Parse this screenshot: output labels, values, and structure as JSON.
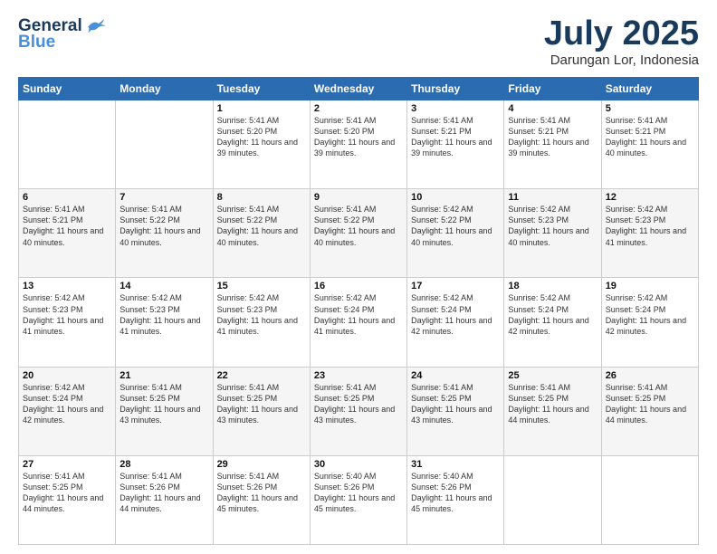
{
  "header": {
    "logo_general": "General",
    "logo_blue": "Blue",
    "month_title": "July 2025",
    "location": "Darungan Lor, Indonesia"
  },
  "weekdays": [
    "Sunday",
    "Monday",
    "Tuesday",
    "Wednesday",
    "Thursday",
    "Friday",
    "Saturday"
  ],
  "weeks": [
    [
      {
        "day": "",
        "info": ""
      },
      {
        "day": "",
        "info": ""
      },
      {
        "day": "1",
        "info": "Sunrise: 5:41 AM\nSunset: 5:20 PM\nDaylight: 11 hours and 39 minutes."
      },
      {
        "day": "2",
        "info": "Sunrise: 5:41 AM\nSunset: 5:20 PM\nDaylight: 11 hours and 39 minutes."
      },
      {
        "day": "3",
        "info": "Sunrise: 5:41 AM\nSunset: 5:21 PM\nDaylight: 11 hours and 39 minutes."
      },
      {
        "day": "4",
        "info": "Sunrise: 5:41 AM\nSunset: 5:21 PM\nDaylight: 11 hours and 39 minutes."
      },
      {
        "day": "5",
        "info": "Sunrise: 5:41 AM\nSunset: 5:21 PM\nDaylight: 11 hours and 40 minutes."
      }
    ],
    [
      {
        "day": "6",
        "info": "Sunrise: 5:41 AM\nSunset: 5:21 PM\nDaylight: 11 hours and 40 minutes."
      },
      {
        "day": "7",
        "info": "Sunrise: 5:41 AM\nSunset: 5:22 PM\nDaylight: 11 hours and 40 minutes."
      },
      {
        "day": "8",
        "info": "Sunrise: 5:41 AM\nSunset: 5:22 PM\nDaylight: 11 hours and 40 minutes."
      },
      {
        "day": "9",
        "info": "Sunrise: 5:41 AM\nSunset: 5:22 PM\nDaylight: 11 hours and 40 minutes."
      },
      {
        "day": "10",
        "info": "Sunrise: 5:42 AM\nSunset: 5:22 PM\nDaylight: 11 hours and 40 minutes."
      },
      {
        "day": "11",
        "info": "Sunrise: 5:42 AM\nSunset: 5:23 PM\nDaylight: 11 hours and 40 minutes."
      },
      {
        "day": "12",
        "info": "Sunrise: 5:42 AM\nSunset: 5:23 PM\nDaylight: 11 hours and 41 minutes."
      }
    ],
    [
      {
        "day": "13",
        "info": "Sunrise: 5:42 AM\nSunset: 5:23 PM\nDaylight: 11 hours and 41 minutes."
      },
      {
        "day": "14",
        "info": "Sunrise: 5:42 AM\nSunset: 5:23 PM\nDaylight: 11 hours and 41 minutes."
      },
      {
        "day": "15",
        "info": "Sunrise: 5:42 AM\nSunset: 5:23 PM\nDaylight: 11 hours and 41 minutes."
      },
      {
        "day": "16",
        "info": "Sunrise: 5:42 AM\nSunset: 5:24 PM\nDaylight: 11 hours and 41 minutes."
      },
      {
        "day": "17",
        "info": "Sunrise: 5:42 AM\nSunset: 5:24 PM\nDaylight: 11 hours and 42 minutes."
      },
      {
        "day": "18",
        "info": "Sunrise: 5:42 AM\nSunset: 5:24 PM\nDaylight: 11 hours and 42 minutes."
      },
      {
        "day": "19",
        "info": "Sunrise: 5:42 AM\nSunset: 5:24 PM\nDaylight: 11 hours and 42 minutes."
      }
    ],
    [
      {
        "day": "20",
        "info": "Sunrise: 5:42 AM\nSunset: 5:24 PM\nDaylight: 11 hours and 42 minutes."
      },
      {
        "day": "21",
        "info": "Sunrise: 5:41 AM\nSunset: 5:25 PM\nDaylight: 11 hours and 43 minutes."
      },
      {
        "day": "22",
        "info": "Sunrise: 5:41 AM\nSunset: 5:25 PM\nDaylight: 11 hours and 43 minutes."
      },
      {
        "day": "23",
        "info": "Sunrise: 5:41 AM\nSunset: 5:25 PM\nDaylight: 11 hours and 43 minutes."
      },
      {
        "day": "24",
        "info": "Sunrise: 5:41 AM\nSunset: 5:25 PM\nDaylight: 11 hours and 43 minutes."
      },
      {
        "day": "25",
        "info": "Sunrise: 5:41 AM\nSunset: 5:25 PM\nDaylight: 11 hours and 44 minutes."
      },
      {
        "day": "26",
        "info": "Sunrise: 5:41 AM\nSunset: 5:25 PM\nDaylight: 11 hours and 44 minutes."
      }
    ],
    [
      {
        "day": "27",
        "info": "Sunrise: 5:41 AM\nSunset: 5:25 PM\nDaylight: 11 hours and 44 minutes."
      },
      {
        "day": "28",
        "info": "Sunrise: 5:41 AM\nSunset: 5:26 PM\nDaylight: 11 hours and 44 minutes."
      },
      {
        "day": "29",
        "info": "Sunrise: 5:41 AM\nSunset: 5:26 PM\nDaylight: 11 hours and 45 minutes."
      },
      {
        "day": "30",
        "info": "Sunrise: 5:40 AM\nSunset: 5:26 PM\nDaylight: 11 hours and 45 minutes."
      },
      {
        "day": "31",
        "info": "Sunrise: 5:40 AM\nSunset: 5:26 PM\nDaylight: 11 hours and 45 minutes."
      },
      {
        "day": "",
        "info": ""
      },
      {
        "day": "",
        "info": ""
      }
    ]
  ]
}
